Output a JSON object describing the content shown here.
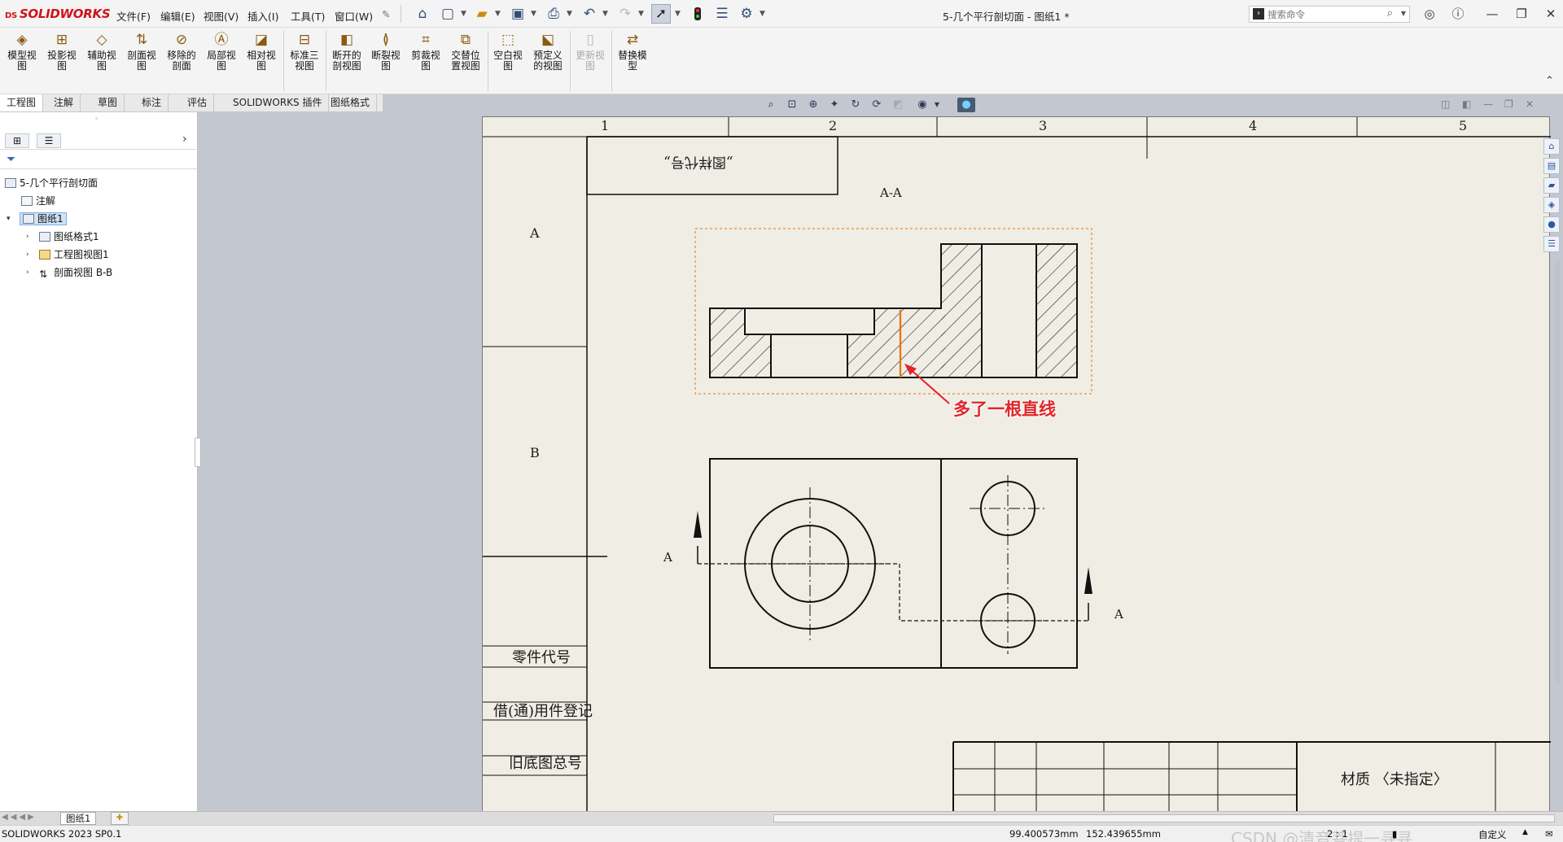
{
  "app": {
    "logo_prefix": "DS",
    "logo_text": "SOLIDWORKS",
    "document_title": "5-几个平行剖切面 - 图纸1 *"
  },
  "menu": [
    "文件(F)",
    "编辑(E)",
    "视图(V)",
    "插入(I)",
    "工具(T)",
    "窗口(W)"
  ],
  "search": {
    "placeholder": "搜索命令"
  },
  "ribbon": [
    {
      "label": "模型视\n图",
      "enabled": true
    },
    {
      "label": "投影视\n图",
      "enabled": true
    },
    {
      "label": "辅助视\n图",
      "enabled": true
    },
    {
      "label": "剖面视\n图",
      "enabled": true
    },
    {
      "label": "移除的\n剖面",
      "enabled": true
    },
    {
      "label": "局部视\n图",
      "enabled": true
    },
    {
      "label": "相对视\n图",
      "enabled": true
    },
    {
      "label": "标准三\n视图",
      "enabled": true
    },
    {
      "label": "断开的\n剖视图",
      "enabled": true
    },
    {
      "label": "断裂视\n图",
      "enabled": true
    },
    {
      "label": "剪裁视\n图",
      "enabled": true
    },
    {
      "label": "交替位\n置视图",
      "enabled": true
    },
    {
      "label": "空白视\n图",
      "enabled": true
    },
    {
      "label": "预定义\n的视图",
      "enabled": true
    },
    {
      "label": "更新视\n图",
      "enabled": false
    },
    {
      "label": "替换模\n型",
      "enabled": true
    }
  ],
  "tabs": [
    "工程图",
    "注解",
    "草图",
    "标注",
    "评估",
    "SOLIDWORKS 插件",
    "图纸格式"
  ],
  "tree": {
    "root": "5-几个平行剖切面",
    "annotations": "注解",
    "sheet": "图纸1",
    "children": [
      "图纸格式1",
      "工程图视图1",
      "剖面视图 B-B"
    ]
  },
  "drawing": {
    "zones_top": [
      "1",
      "2",
      "3",
      "4",
      "5"
    ],
    "zones_left": [
      "A",
      "B"
    ],
    "mirrored_label": "„图样代号„",
    "section_title": "A-A",
    "cut_label_left": "A",
    "cut_label_right": "A",
    "annotation": "多了一根直线",
    "left_table": [
      "零件代号",
      "借(通)用件登记",
      "旧底图总号"
    ],
    "material": "材质 〈未指定〉"
  },
  "sheet_tab": "图纸1",
  "status": {
    "version": "SOLIDWORKS 2023 SP0.1",
    "x": "99.400573mm",
    "y": "152.439655mm",
    "scale": "2 : 1",
    "custom": "自定义",
    "watermark": "CSDN @清音菩提一寻寻"
  },
  "colors": {
    "sheet_bg": "#efede4",
    "canvas_bg": "#c3c7d0",
    "highlight_line": "#e8720c",
    "annotation_red": "#e0262b",
    "logo": "#d0121b"
  }
}
